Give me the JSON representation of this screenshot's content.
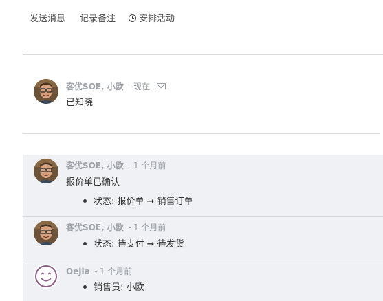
{
  "toolbar": {
    "send_message": "发送消息",
    "log_note": "记录备注",
    "schedule_activity": "安排活动"
  },
  "messages": [
    {
      "author": "客优SOE, 小欧",
      "time": "现在",
      "body": "已知晓",
      "avatar": "man-with-glasses"
    },
    {
      "author": "客优SOE, 小欧",
      "time": "1 个月前",
      "body": "报价单已确认",
      "avatar": "man-with-glasses",
      "tracking": {
        "field": "状态:",
        "old": "报价单",
        "new": "销售订单"
      }
    },
    {
      "author": "客优SOE, 小欧",
      "time": "1 个月前",
      "avatar": "man-with-glasses",
      "tracking": {
        "field": "状态:",
        "old": "待支付",
        "new": "待发货"
      }
    },
    {
      "author": "Oejia",
      "time": "1 个月前",
      "avatar": "smiley",
      "tracking": {
        "field": "销售员:",
        "new": "小欧"
      }
    }
  ],
  "arrow": "➞",
  "dash": "-",
  "colors": {
    "note_bg": "#eff1f4",
    "meta_text": "#9ba0a6",
    "divider": "#dadada"
  }
}
